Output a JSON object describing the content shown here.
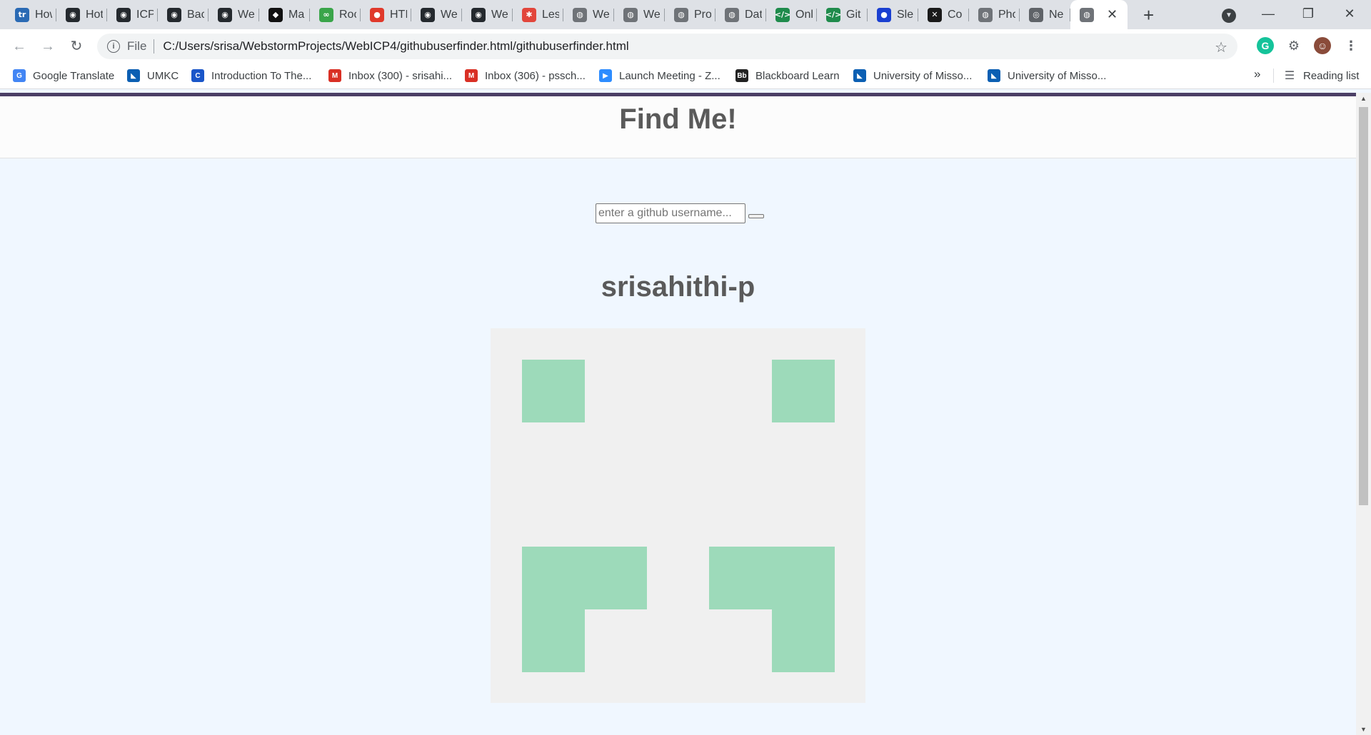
{
  "browser": {
    "tabs": [
      {
        "title": "How",
        "icon": "trello-icon",
        "color": "#2a6ab4",
        "glyph": "tr"
      },
      {
        "title": "Hot",
        "icon": "github-icon",
        "color": "#24292e",
        "glyph": "◉"
      },
      {
        "title": "ICP",
        "icon": "github-icon",
        "color": "#24292e",
        "glyph": "◉"
      },
      {
        "title": "Bac",
        "icon": "github-icon",
        "color": "#24292e",
        "glyph": "◉"
      },
      {
        "title": "We",
        "icon": "github-icon",
        "color": "#24292e",
        "glyph": "◉"
      },
      {
        "title": "Ma",
        "icon": "app-icon",
        "color": "#111111",
        "glyph": "◆"
      },
      {
        "title": "Roc",
        "icon": "link-icon",
        "color": "#3aa54a",
        "glyph": "∞"
      },
      {
        "title": "HTI",
        "icon": "record-icon",
        "color": "#e0392b",
        "glyph": "●"
      },
      {
        "title": "We",
        "icon": "github-icon",
        "color": "#24292e",
        "glyph": "◉"
      },
      {
        "title": "We",
        "icon": "github-icon",
        "color": "#24292e",
        "glyph": "◉"
      },
      {
        "title": "Les",
        "icon": "gear-icon",
        "color": "#e2463c",
        "glyph": "✱"
      },
      {
        "title": "We",
        "icon": "globe-icon",
        "color": "#6f7378",
        "glyph": "◍"
      },
      {
        "title": "We",
        "icon": "globe-icon",
        "color": "#6f7378",
        "glyph": "◍"
      },
      {
        "title": "Pro",
        "icon": "globe-icon",
        "color": "#6f7378",
        "glyph": "◍"
      },
      {
        "title": "Dat",
        "icon": "globe-icon",
        "color": "#6f7378",
        "glyph": "◍"
      },
      {
        "title": "Onl",
        "icon": "code-icon",
        "color": "#1f8b4c",
        "glyph": "</>"
      },
      {
        "title": "Git",
        "icon": "code-icon",
        "color": "#1f8b4c",
        "glyph": "</>"
      },
      {
        "title": "Sle",
        "icon": "circle-icon",
        "color": "#1a3fd1",
        "glyph": "●"
      },
      {
        "title": "Co",
        "icon": "app-icon",
        "color": "#1a1a1a",
        "glyph": "✕"
      },
      {
        "title": "Pho",
        "icon": "globe-icon",
        "color": "#6f7378",
        "glyph": "◍"
      },
      {
        "title": "Ne",
        "icon": "chrome-icon",
        "color": "#5f6368",
        "glyph": "◎"
      }
    ],
    "active_tab": {
      "title": "",
      "icon": "globe-icon"
    },
    "new_tab_label": "+",
    "address": {
      "scheme_label": "File",
      "url": "C:/Users/srisa/WebstormProjects/WebICP4/githubuserfinder.html/githubuserfinder.html"
    },
    "bookmarks": [
      {
        "label": "Google Translate",
        "icon": "translate-icon",
        "color": "#4285f4",
        "glyph": "G"
      },
      {
        "label": "UMKC",
        "icon": "umkc-icon",
        "color": "#0b5fb3",
        "glyph": "◣"
      },
      {
        "label": "Introduction To The...",
        "icon": "c-icon",
        "color": "#1a56c9",
        "glyph": "C"
      },
      {
        "label": "Inbox (300) - srisahi...",
        "icon": "gmail-icon",
        "color": "#d93025",
        "glyph": "M"
      },
      {
        "label": "Inbox (306) - pssch...",
        "icon": "gmail-icon",
        "color": "#d93025",
        "glyph": "M"
      },
      {
        "label": "Launch Meeting - Z...",
        "icon": "zoom-icon",
        "color": "#2d8cff",
        "glyph": "▶"
      },
      {
        "label": "Blackboard Learn",
        "icon": "blackboard-icon",
        "color": "#222222",
        "glyph": "Bb"
      },
      {
        "label": "University of Misso...",
        "icon": "umkc-icon",
        "color": "#0b5fb3",
        "glyph": "◣"
      },
      {
        "label": "University of Misso...",
        "icon": "umkc-icon",
        "color": "#0b5fb3",
        "glyph": "◣"
      }
    ],
    "bookmarks_overflow": "»",
    "reading_list_label": "Reading list"
  },
  "page": {
    "title": "Find Me!",
    "search_placeholder": "enter a github username...",
    "search_value": "",
    "username": "srisahithi-p",
    "avatar": {
      "background": "#f0f0f0",
      "color": "#9ddaba",
      "grid": [
        [
          1,
          0,
          0,
          0,
          1
        ],
        [
          0,
          0,
          0,
          0,
          0
        ],
        [
          0,
          0,
          0,
          0,
          0
        ],
        [
          1,
          1,
          0,
          1,
          1
        ],
        [
          1,
          0,
          0,
          0,
          1
        ]
      ]
    }
  }
}
